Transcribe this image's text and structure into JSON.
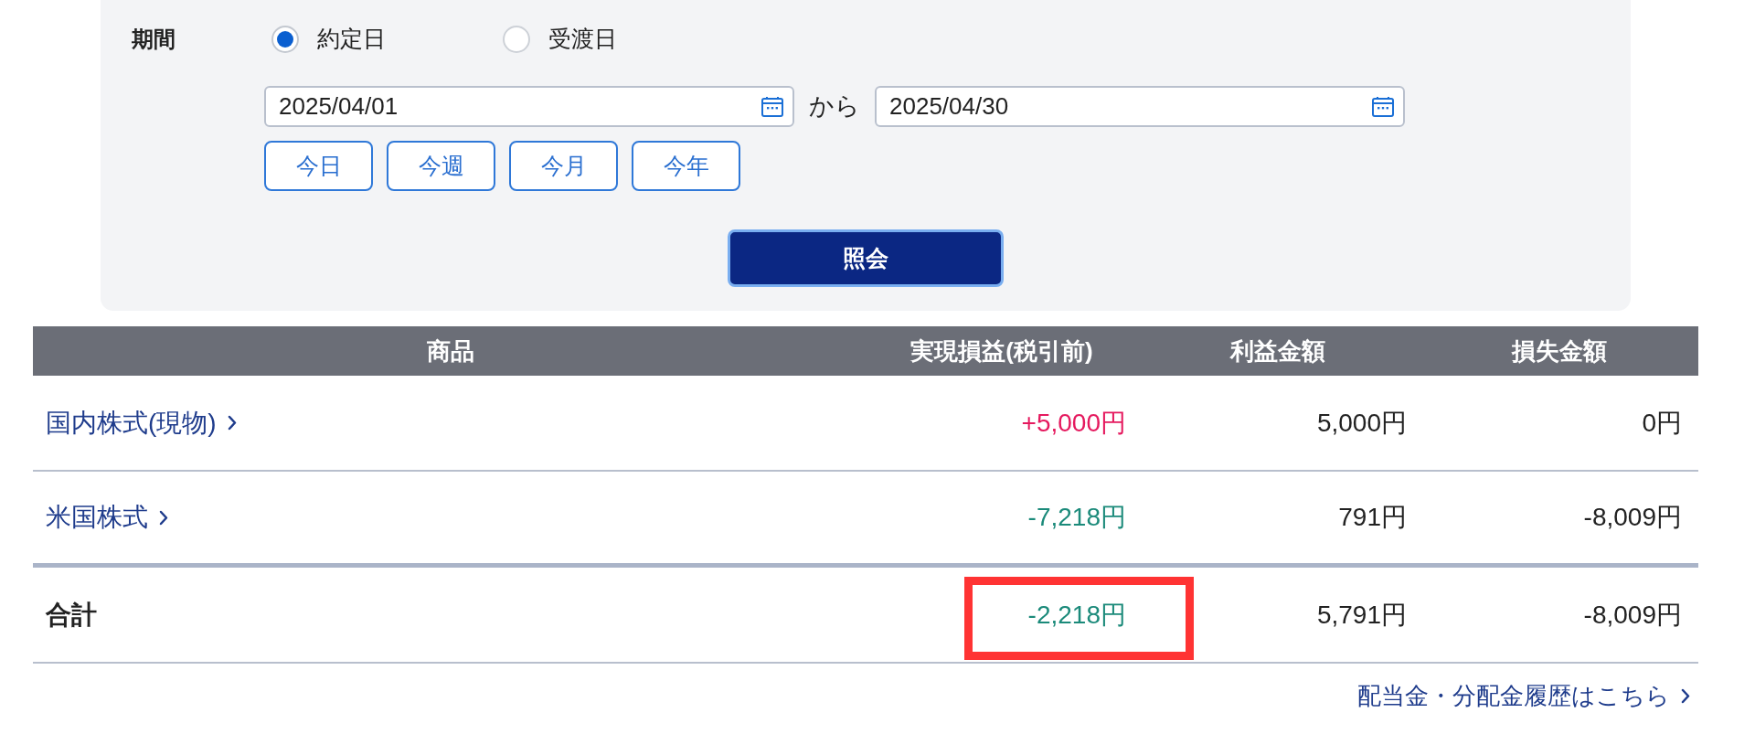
{
  "period": {
    "label": "期間",
    "radios": [
      {
        "label": "約定日",
        "selected": true
      },
      {
        "label": "受渡日",
        "selected": false
      }
    ],
    "from_date": "2025/04/01",
    "separator": "から",
    "to_date": "2025/04/30",
    "quick_buttons": [
      "今日",
      "今週",
      "今月",
      "今年"
    ]
  },
  "search_button": "照会",
  "table": {
    "columns": [
      "商品",
      "実現損益(税引前)",
      "利益金額",
      "損失金額"
    ],
    "rows": [
      {
        "product": "国内株式(現物)",
        "realized": "+5,000円",
        "negative": false,
        "profit": "5,000円",
        "loss": "0円"
      },
      {
        "product": "米国株式",
        "realized": "-7,218円",
        "negative": true,
        "profit": "791円",
        "loss": "-8,009円"
      }
    ],
    "total": {
      "label": "合計",
      "realized": "-2,218円",
      "negative": true,
      "profit": "5,791円",
      "loss": "-8,009円",
      "highlighted": true
    }
  },
  "footer_link": "配当金・分配金履歴はこちら"
}
